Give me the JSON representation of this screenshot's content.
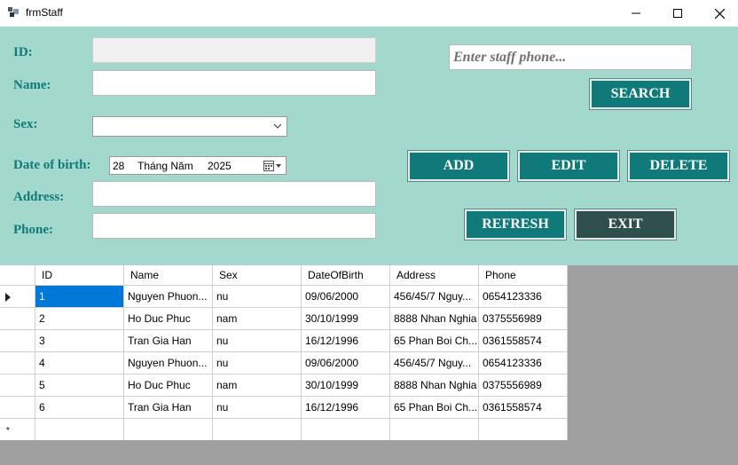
{
  "window": {
    "title": "frmStaff"
  },
  "form": {
    "id_label": "ID:",
    "name_label": "Name:",
    "sex_label": "Sex:",
    "dob_label": "Date of birth:",
    "address_label": "Address:",
    "phone_label": "Phone:",
    "id_value": "",
    "name_value": "",
    "sex_value": "",
    "address_value": "",
    "phone_value": "",
    "dob": {
      "day": "28",
      "month": "Tháng Năm",
      "year": "2025"
    }
  },
  "search": {
    "placeholder": "Enter staff phone...",
    "button": "SEARCH"
  },
  "buttons": {
    "add": "ADD",
    "edit": "EDIT",
    "delete": "DELETE",
    "refresh": "REFRESH",
    "exit": "EXIT"
  },
  "grid": {
    "columns": [
      "ID",
      "Name",
      "Sex",
      "DateOfBirth",
      "Address",
      "Phone"
    ],
    "rows": [
      [
        "1",
        "Nguyen Phuon...",
        "nu",
        "09/06/2000",
        "456/45/7 Nguy...",
        "0654123336"
      ],
      [
        "2",
        "Ho Duc Phuc",
        "nam",
        "30/10/1999",
        "8888 Nhan Nghia",
        "0375556989"
      ],
      [
        "3",
        "Tran Gia Han",
        "nu",
        "16/12/1996",
        "65 Phan Boi Ch...",
        "0361558574"
      ],
      [
        "4",
        "Nguyen Phuon...",
        "nu",
        "09/06/2000",
        "456/45/7 Nguy...",
        "0654123336"
      ],
      [
        "5",
        "Ho Duc Phuc",
        "nam",
        "30/10/1999",
        "8888 Nhan Nghia",
        "0375556989"
      ],
      [
        "6",
        "Tran Gia Han",
        "nu",
        "16/12/1996",
        "65 Phan Boi Ch...",
        "0361558574"
      ]
    ],
    "new_row_marker": "*"
  },
  "colors": {
    "panel": "#a3d9cc",
    "label": "#107a7a",
    "button": "#107a7a",
    "exit_button": "#2f4f4f",
    "selection": "#0078d7"
  }
}
